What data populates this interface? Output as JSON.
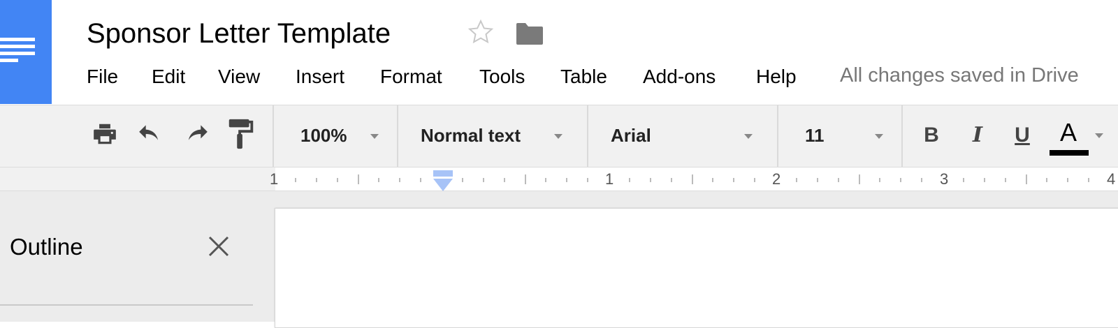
{
  "app": {
    "logo_icon": "docs-icon",
    "brand_color": "#4285f4"
  },
  "document": {
    "title": "Sponsor Letter Template"
  },
  "title_actions": {
    "star_icon": "star-icon",
    "folder_icon": "folder-icon"
  },
  "menubar": {
    "items": [
      {
        "label": "File"
      },
      {
        "label": "Edit"
      },
      {
        "label": "View"
      },
      {
        "label": "Insert"
      },
      {
        "label": "Format"
      },
      {
        "label": "Tools"
      },
      {
        "label": "Table"
      },
      {
        "label": "Add-ons"
      },
      {
        "label": "Help"
      }
    ],
    "save_status": "All changes saved in Drive"
  },
  "toolbar": {
    "icons": [
      "print-icon",
      "undo-icon",
      "redo-icon",
      "paint-format-icon"
    ],
    "zoom": "100%",
    "paragraph_style": "Normal text",
    "font": "Arial",
    "font_size": "11",
    "bold_label": "B",
    "italic_label": "I",
    "underline_label": "U",
    "text_color_label": "A",
    "text_color": "#000000"
  },
  "ruler": {
    "numbers": [
      "1",
      "1",
      "2",
      "3",
      "4"
    ],
    "indent_color": "#a7c3f7"
  },
  "outline": {
    "title": "Outline",
    "close_icon": "close-icon"
  }
}
